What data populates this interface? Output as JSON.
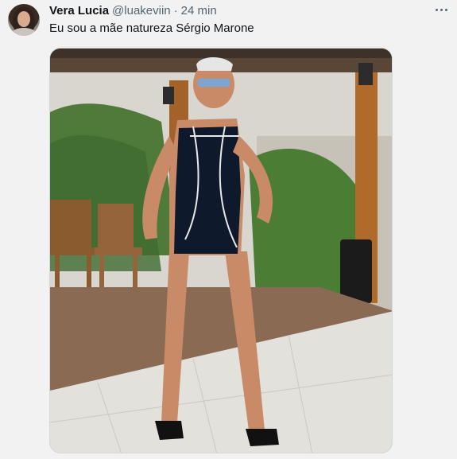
{
  "tweet": {
    "author_name": "Vera Lucia",
    "author_handle": "@luakeviin",
    "separator": "·",
    "timestamp": "24 min",
    "text": "Eu sou a mãe natureza Sérgio Marone",
    "more_icon": "more-horizontal-icon",
    "avatar": "user-avatar",
    "media": "photo"
  }
}
